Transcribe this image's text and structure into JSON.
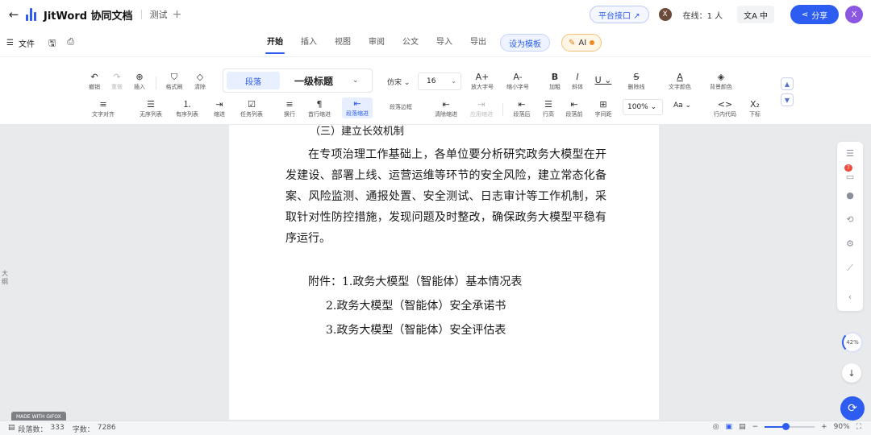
{
  "topbar": {
    "back_icon": "arrow-left-icon",
    "app_title": "JitWord 协同文档",
    "doc_name": "测试",
    "new_tab_icon": "plus-icon",
    "api_button": "平台接口 ↗",
    "collab_avatar": "X",
    "online_label": "在线：1 人",
    "lang_button": "中",
    "share_button": "分享",
    "user_avatar": "X",
    "brand_color": "#2c5cf0"
  },
  "menubar": {
    "file_label": "文件",
    "tabs": [
      "开始",
      "插入",
      "视图",
      "审阅",
      "公文",
      "导入",
      "导出"
    ],
    "active_tab": "开始",
    "template_button": "设为模板",
    "ai_button": "AI"
  },
  "toolbar": {
    "row1": [
      "撤销",
      "重做",
      "插入",
      "格式刷",
      "清除"
    ],
    "paragraph_chip": "段落",
    "heading_style": "一级标题",
    "font_family": "仿宋",
    "font_size": "16",
    "row1_right": [
      "放大字号",
      "缩小字号",
      "加粗",
      "斜体",
      "",
      "删除线",
      "文字颜色",
      "背景颜色"
    ],
    "row2": [
      "文字对齐",
      "无序列表",
      "有序列表",
      "缩进",
      "任务列表",
      "换行",
      "首行缩进",
      "段落缩进",
      "段落边框",
      "清除缩进",
      "应用缩进",
      "段落后",
      "行高",
      "段落前",
      "字间距"
    ],
    "zoom": "100%",
    "aa": "Aa",
    "code_label": "行内代码",
    "subscript_label": "下标"
  },
  "document": {
    "subheading": "（三）建立长效机制",
    "paragraph": "在专项治理工作基础上，各单位要分析研究政务大模型在开发建设、部署上线、运营运维等环节的安全风险，建立常态化备案、风险监测、通报处置、安全测试、日志审计等工作机制，采取针对性防控措施，发现问题及时整改，确保政务大模型平稳有序运行。",
    "attachments": [
      "附件：1.政务大模型（智能体）基本情况表",
      "2.政务大模型（智能体）安全承诺书",
      "3.政务大模型（智能体）安全评估表"
    ]
  },
  "left_strip": "大纲",
  "rail": {
    "badge": "7",
    "progress_label": "42%"
  },
  "watermark": "MADE WITH GIFOX",
  "status": {
    "para_label": "段落数：",
    "para_count": "333",
    "word_label": "字数：",
    "word_count": "7286",
    "zoom": "90%"
  }
}
